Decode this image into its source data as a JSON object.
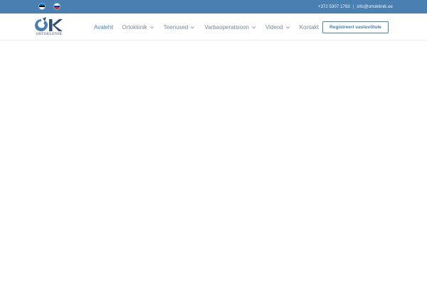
{
  "topbar": {
    "languages": [
      {
        "name": "estonian-flag",
        "colors": [
          "#0072ce",
          "#000000",
          "#ffffff"
        ]
      },
      {
        "name": "russian-flag",
        "colors": [
          "#ffffff",
          "#0039a6",
          "#d52b1e"
        ]
      }
    ],
    "phone": "+372 5307 1783",
    "separator": "|",
    "email": "info@ortokliinik.ee"
  },
  "logo": {
    "text": "ORTOKLIINIK"
  },
  "nav": {
    "items": [
      {
        "label": "Avaleht",
        "dropdown": false,
        "active": true
      },
      {
        "label": "Ortokliinik",
        "dropdown": true,
        "active": false
      },
      {
        "label": "Teenused",
        "dropdown": true,
        "active": false
      },
      {
        "label": "Varbaoperatsioon",
        "dropdown": true,
        "active": false
      },
      {
        "label": "Videod",
        "dropdown": true,
        "active": false
      },
      {
        "label": "Kontakt",
        "dropdown": false,
        "active": false
      }
    ],
    "cta_label": "Registreeri vastuvõtule"
  },
  "colors": {
    "brand_blue": "#4a7fb2",
    "nav_text": "#7a8894",
    "logo_dark": "#2f4f75"
  }
}
